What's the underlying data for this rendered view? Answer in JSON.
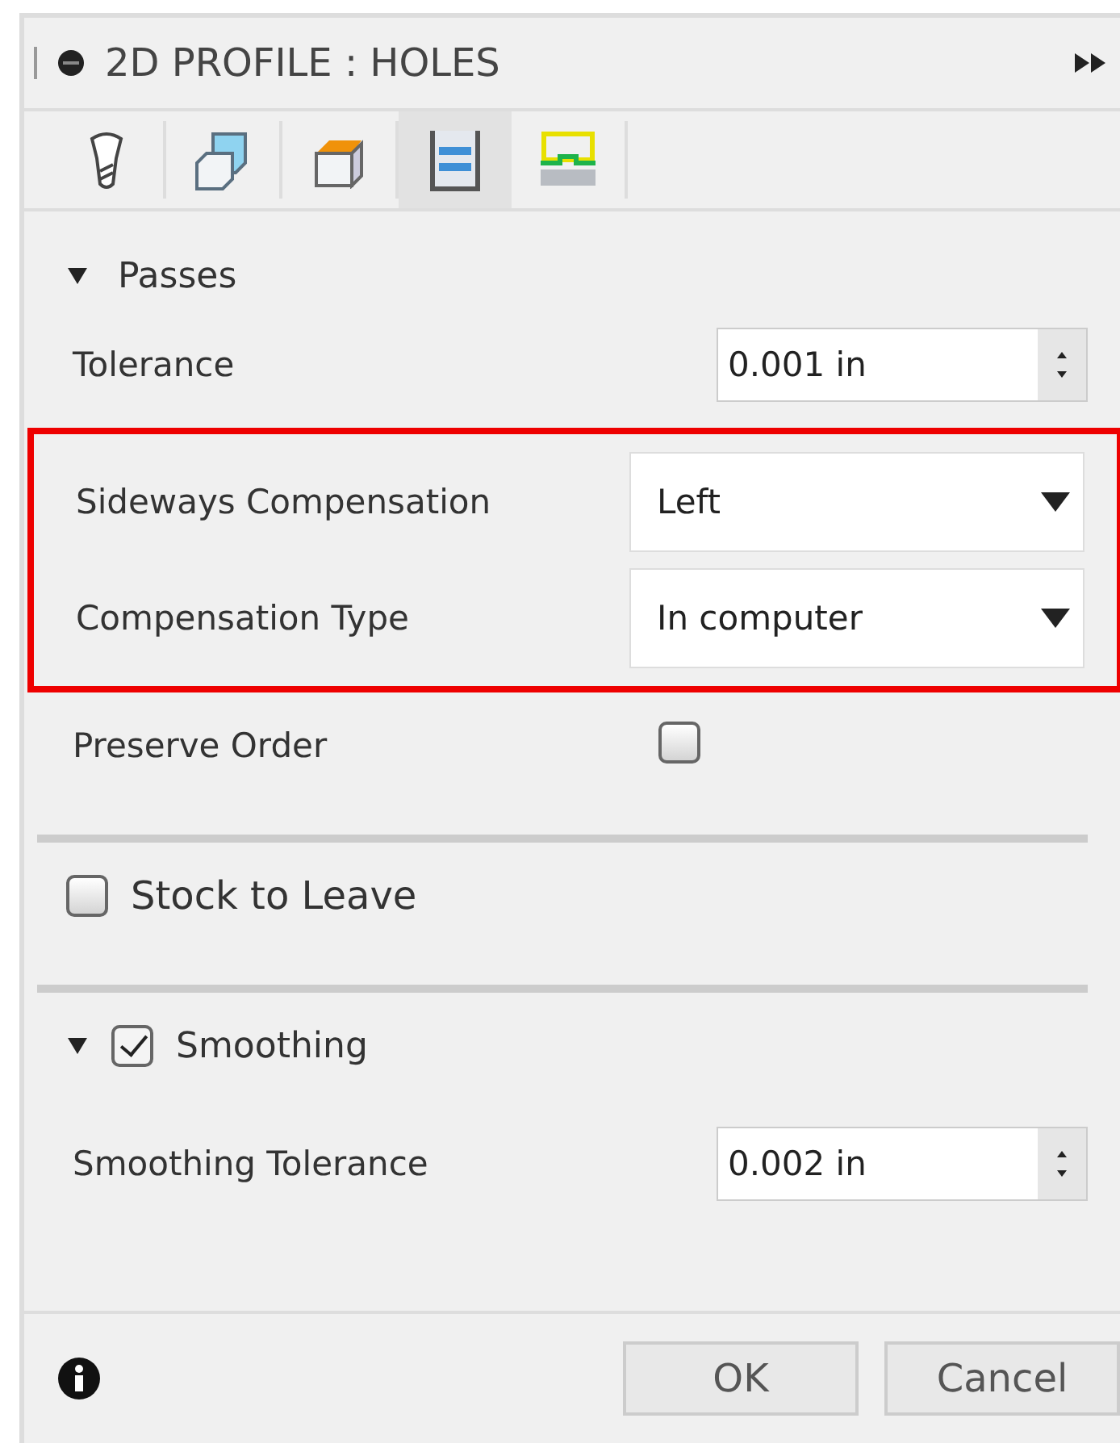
{
  "window": {
    "title": "2D PROFILE : HOLES"
  },
  "tabs": [
    {
      "kind": "tool",
      "selected": false
    },
    {
      "kind": "geometry",
      "selected": false
    },
    {
      "kind": "heights",
      "selected": false
    },
    {
      "kind": "passes",
      "selected": true
    },
    {
      "kind": "linking",
      "selected": false
    }
  ],
  "passes": {
    "title": "Passes",
    "expanded": true,
    "tolerance": {
      "label": "Tolerance",
      "value": "0.001 in"
    },
    "highlighted": [
      {
        "label": "Sideways Compensation",
        "value": "Left"
      },
      {
        "label": "Compensation Type",
        "value": "In computer"
      }
    ],
    "preserve_order": {
      "label": "Preserve Order",
      "checked": false
    }
  },
  "stock_to_leave": {
    "label": "Stock to Leave",
    "checked": false
  },
  "smoothing": {
    "label": "Smoothing",
    "expanded": true,
    "checked": true,
    "tolerance": {
      "label": "Smoothing Tolerance",
      "value": "0.002 in"
    }
  },
  "buttons": [
    {
      "label": "OK"
    },
    {
      "label": "Cancel"
    }
  ]
}
